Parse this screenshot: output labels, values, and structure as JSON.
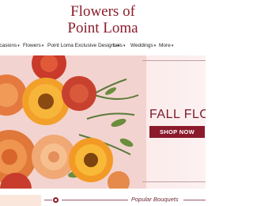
{
  "brand": {
    "line1": "Flowers of",
    "line2": "Point Loma"
  },
  "nav": [
    {
      "label": "ccasions"
    },
    {
      "label": "Flowers"
    },
    {
      "label": "Point Loma Exclusive Designs"
    },
    {
      "label": "Leis"
    },
    {
      "label": "Weddings"
    },
    {
      "label": "More"
    }
  ],
  "hero": {
    "heading": "FALL FLO",
    "button": "SHOP NOW"
  },
  "section": {
    "title": "Popular Bouquets"
  },
  "colors": {
    "brand": "#8a1c2b",
    "button": "#8b1a2b",
    "hero_bg": "#f9e2e2"
  }
}
